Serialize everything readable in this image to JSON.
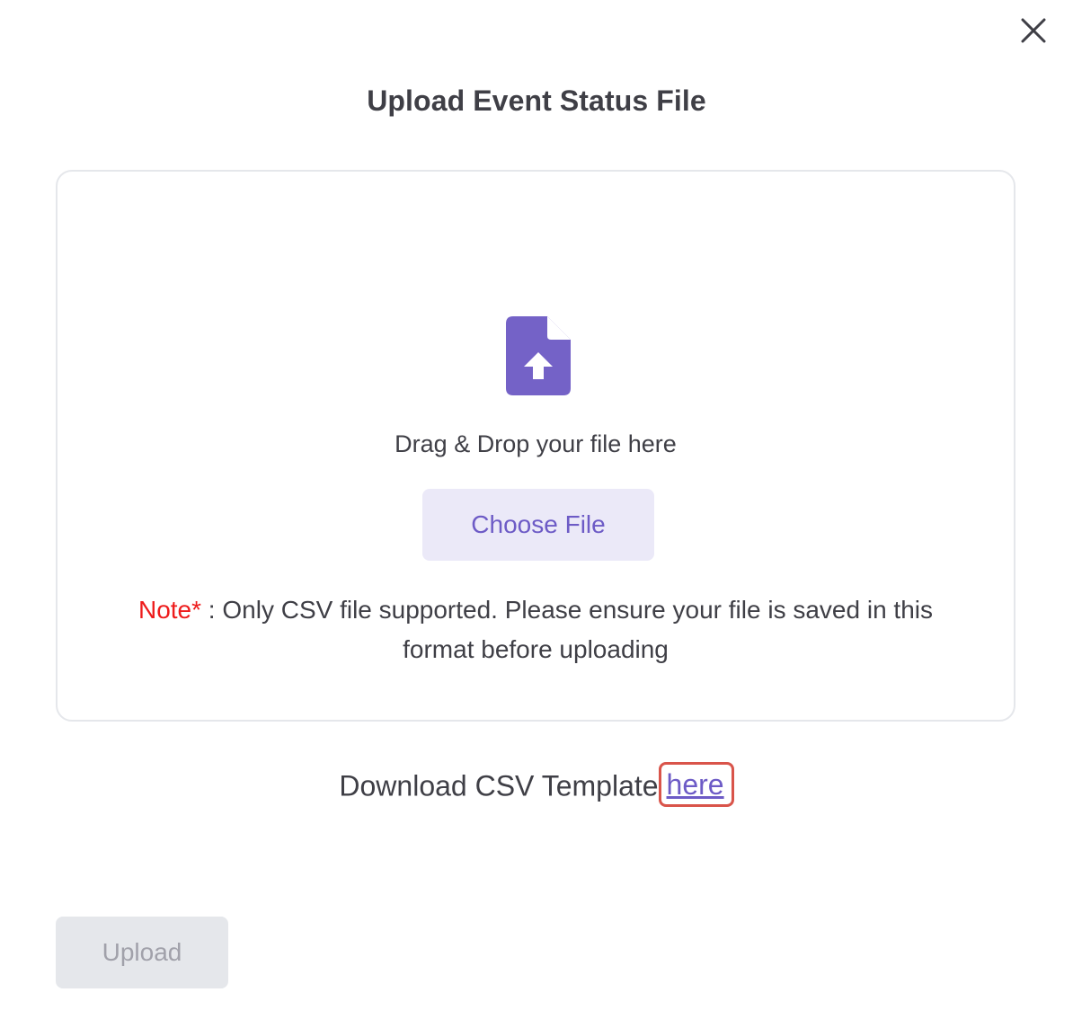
{
  "modal": {
    "title": "Upload Event Status File",
    "close_icon": "close-icon"
  },
  "dropzone": {
    "icon": "file-upload-icon",
    "drag_text": "Drag & Drop your file here",
    "choose_label": "Choose File",
    "note_label": "Note*",
    "note_text": " : Only CSV file supported. Please ensure your file is saved in this format before uploading"
  },
  "download": {
    "prefix": "Download CSV Template",
    "link_label": "here"
  },
  "footer": {
    "upload_label": "Upload"
  },
  "colors": {
    "accent": "#6d5bc6",
    "accent_bg": "#ebe9f8",
    "note_red": "#ee1c1c",
    "highlight_border": "#d9544a",
    "disabled_bg": "#e5e7eb",
    "disabled_text": "#a1a1aa"
  }
}
